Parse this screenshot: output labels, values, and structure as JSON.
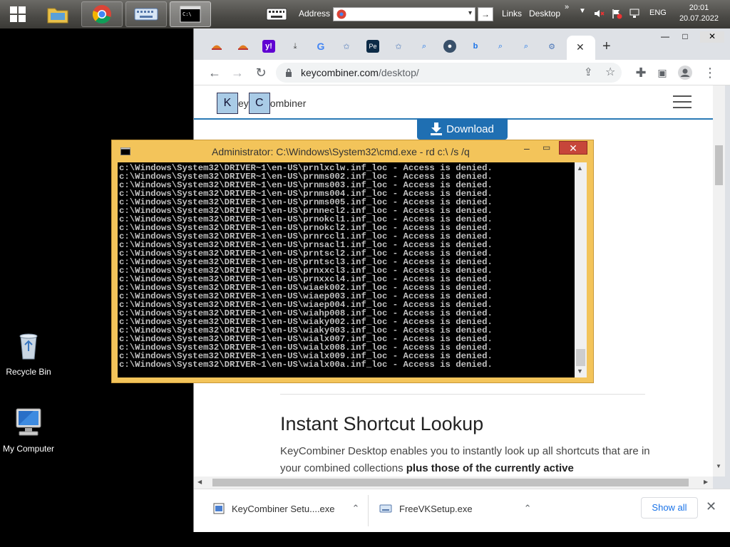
{
  "taskbar": {
    "address_label": "Address",
    "links_label": "Links",
    "desktop_label": "Desktop",
    "lang": "ENG",
    "time": "20:01",
    "date": "20.07.2022"
  },
  "desktop": {
    "icons": [
      {
        "label": "Recycle Bin"
      },
      {
        "label": "My Computer"
      }
    ]
  },
  "browser": {
    "url_host": "keycombiner.com",
    "url_path": "/desktop/",
    "tab_close": "✕",
    "new_tab": "+"
  },
  "page": {
    "logo_k": "K",
    "logo_ey": "ey",
    "logo_c": "C",
    "logo_ombiner": "ombiner",
    "download_label": "Download",
    "section_title": "Instant Shortcut Lookup",
    "section_text_plain": "KeyCombiner Desktop enables you to instantly look up all shortcuts that are in your combined collections ",
    "section_text_bold": "plus those of the currently active"
  },
  "downloads": {
    "items": [
      {
        "name": "KeyCombiner Setu....exe"
      },
      {
        "name": "FreeVKSetup.exe"
      }
    ],
    "show_all": "Show all"
  },
  "cmd": {
    "title": "Administrator: C:\\Windows\\System32\\cmd.exe - rd  c:\\ /s /q",
    "lines": [
      "c:\\Windows\\System32\\DRIVER~1\\en-US\\prnlxclw.inf_loc - Access is denied.",
      "c:\\Windows\\System32\\DRIVER~1\\en-US\\prnms002.inf_loc - Access is denied.",
      "c:\\Windows\\System32\\DRIVER~1\\en-US\\prnms003.inf_loc - Access is denied.",
      "c:\\Windows\\System32\\DRIVER~1\\en-US\\prnms004.inf_loc - Access is denied.",
      "c:\\Windows\\System32\\DRIVER~1\\en-US\\prnms005.inf_loc - Access is denied.",
      "c:\\Windows\\System32\\DRIVER~1\\en-US\\prnnecl2.inf_loc - Access is denied.",
      "c:\\Windows\\System32\\DRIVER~1\\en-US\\prnokcl1.inf_loc - Access is denied.",
      "c:\\Windows\\System32\\DRIVER~1\\en-US\\prnokcl2.inf_loc - Access is denied.",
      "c:\\Windows\\System32\\DRIVER~1\\en-US\\prnrccl1.inf_loc - Access is denied.",
      "c:\\Windows\\System32\\DRIVER~1\\en-US\\prnsacl1.inf_loc - Access is denied.",
      "c:\\Windows\\System32\\DRIVER~1\\en-US\\prntscl2.inf_loc - Access is denied.",
      "c:\\Windows\\System32\\DRIVER~1\\en-US\\prntscl3.inf_loc - Access is denied.",
      "c:\\Windows\\System32\\DRIVER~1\\en-US\\prnxxcl3.inf_loc - Access is denied.",
      "c:\\Windows\\System32\\DRIVER~1\\en-US\\prnxxcl4.inf_loc - Access is denied.",
      "c:\\Windows\\System32\\DRIVER~1\\en-US\\wiaek002.inf_loc - Access is denied.",
      "c:\\Windows\\System32\\DRIVER~1\\en-US\\wiaep003.inf_loc - Access is denied.",
      "c:\\Windows\\System32\\DRIVER~1\\en-US\\wiaep004.inf_loc - Access is denied.",
      "c:\\Windows\\System32\\DRIVER~1\\en-US\\wiahp008.inf_loc - Access is denied.",
      "c:\\Windows\\System32\\DRIVER~1\\en-US\\wiaky002.inf_loc - Access is denied.",
      "c:\\Windows\\System32\\DRIVER~1\\en-US\\wiaky003.inf_loc - Access is denied.",
      "c:\\Windows\\System32\\DRIVER~1\\en-US\\wialx007.inf_loc - Access is denied.",
      "c:\\Windows\\System32\\DRIVER~1\\en-US\\wialx008.inf_loc - Access is denied.",
      "c:\\Windows\\System32\\DRIVER~1\\en-US\\wialx009.inf_loc - Access is denied.",
      "c:\\Windows\\System32\\DRIVER~1\\en-US\\wialx00a.inf_loc - Access is denied."
    ]
  },
  "colors": {
    "cmd_frame": "#f3c45a",
    "cmd_close": "#c7463a",
    "download_button": "#1f6fb2"
  }
}
